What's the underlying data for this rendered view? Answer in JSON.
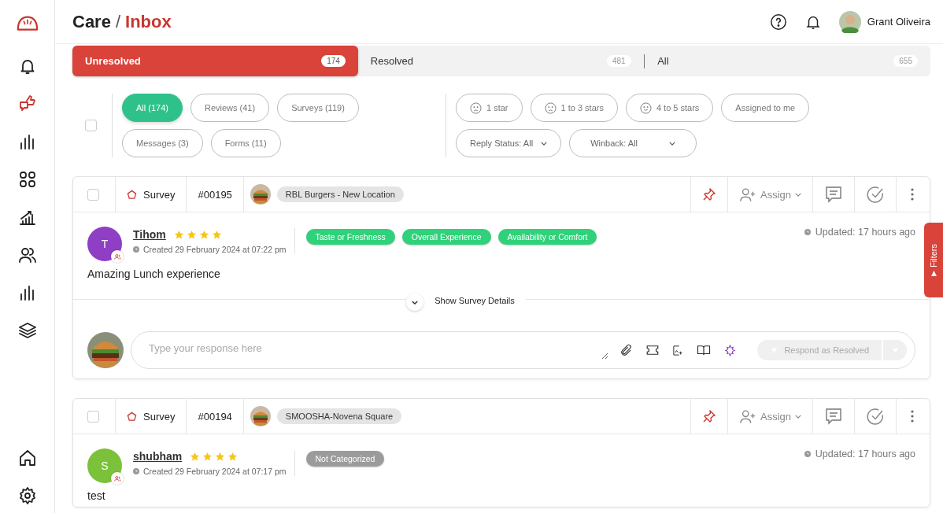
{
  "sidebar": {
    "items": [
      {
        "selected": false
      },
      {
        "selected": true
      },
      {
        "selected": false
      },
      {
        "selected": false
      },
      {
        "selected": false
      },
      {
        "selected": false
      },
      {
        "selected": false
      },
      {
        "selected": false
      }
    ],
    "bottom_items": [
      {
        "selected": false
      },
      {
        "selected": false
      }
    ]
  },
  "header": {
    "section": "Care",
    "separator": "/",
    "page": "Inbox",
    "user": "Grant Oliveira"
  },
  "status_tabs": [
    {
      "label": "Unresolved",
      "count": "174",
      "selected": true
    },
    {
      "label": "Resolved",
      "count": "481",
      "selected": false
    },
    {
      "label": "All",
      "count": "655",
      "selected": false
    }
  ],
  "type_filters": [
    {
      "label": "All (174)",
      "selected": true
    },
    {
      "label": "Reviews (41)",
      "selected": false
    },
    {
      "label": "Surveys (119)",
      "selected": false
    },
    {
      "label": "Messages (3)",
      "selected": false
    },
    {
      "label": "Forms (11)",
      "selected": false
    }
  ],
  "rating_filters": [
    {
      "label": "1 star",
      "kind": "sad"
    },
    {
      "label": "1 to 3 stars",
      "kind": "sad"
    },
    {
      "label": "4 to 5 stars",
      "kind": "happy"
    },
    {
      "label": "Assigned to me",
      "kind": "plain"
    }
  ],
  "select_all": {
    "checked": false
  },
  "dropdowns": [
    {
      "label": "Reply Status: All"
    },
    {
      "label": "Winback: All"
    }
  ],
  "cards": [
    {
      "checked": false,
      "type": "Survey",
      "number": "#00195",
      "location": "RBL Burgers - New Location",
      "assign": "Assign",
      "author": "Tihom",
      "initial": "T",
      "color": "#8e3fc4",
      "stars": 4,
      "created": "Created 29 February 2024 at 07:22 pm",
      "updated": "Updated: 17 hours ago",
      "tags": [
        {
          "label": "Taste or Freshness",
          "color": "#2fd17a"
        },
        {
          "label": "Overall Experience",
          "color": "#2fd17a"
        },
        {
          "label": "Availability or Comfort",
          "color": "#2fd17a"
        }
      ],
      "message": "Amazing Lunch experience",
      "details": "Show Survey Details",
      "reply": {
        "placeholder": "Type your response here",
        "button": "Respond as Resolved"
      }
    },
    {
      "checked": false,
      "type": "Survey",
      "number": "#00194",
      "location": "SMOOSHA-Novena Square",
      "assign": "Assign",
      "author": "shubham",
      "initial": "S",
      "color": "#7cc13a",
      "stars": 4,
      "created": "Created 29 February 2024 at 07:17 pm",
      "updated": "Updated: 17 hours ago",
      "tags": [
        {
          "label": "Not Categorized",
          "color": "#9b9b9b"
        }
      ],
      "message": "test"
    }
  ],
  "filters_tab": "Filters"
}
